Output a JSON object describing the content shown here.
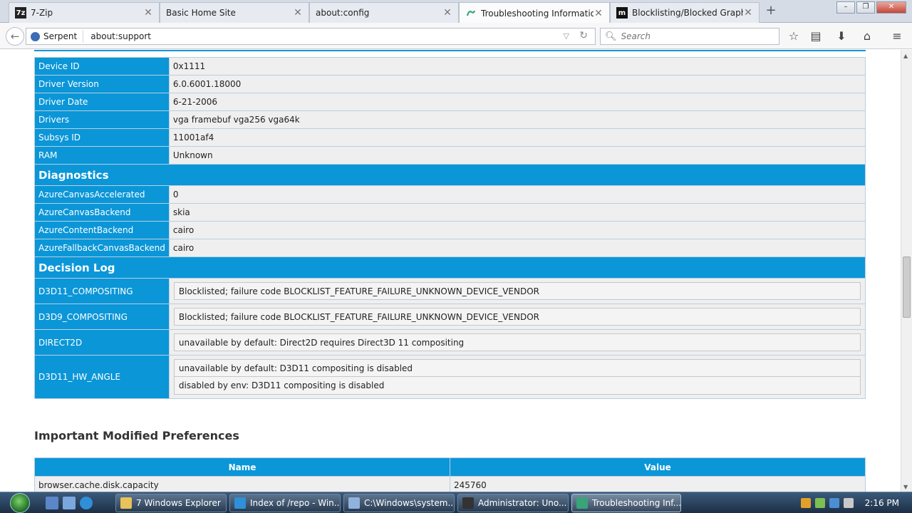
{
  "tabs": [
    {
      "title": "7-Zip",
      "favicon": "7z"
    },
    {
      "title": "Basic Home Site",
      "favicon": ""
    },
    {
      "title": "about:config",
      "favicon": ""
    },
    {
      "title": "Troubleshooting Informatio",
      "favicon": "serpent-icon"
    },
    {
      "title": "Blocklisting/Blocked Graphi",
      "favicon": "m"
    }
  ],
  "navbar": {
    "identity": "Serpent",
    "url": "about:support",
    "search_placeholder": "Search"
  },
  "graphics_rows": [
    {
      "key": "Device ID",
      "value": "0x1111"
    },
    {
      "key": "Driver Version",
      "value": "6.0.6001.18000"
    },
    {
      "key": "Driver Date",
      "value": "6-21-2006"
    },
    {
      "key": "Drivers",
      "value": "vga framebuf vga256 vga64k"
    },
    {
      "key": "Subsys ID",
      "value": "11001af4"
    },
    {
      "key": "RAM",
      "value": "Unknown"
    }
  ],
  "diagnostics": {
    "title": "Diagnostics",
    "rows": [
      {
        "key": "AzureCanvasAccelerated",
        "value": "0"
      },
      {
        "key": "AzureCanvasBackend",
        "value": "skia"
      },
      {
        "key": "AzureContentBackend",
        "value": "cairo"
      },
      {
        "key": "AzureFallbackCanvasBackend",
        "value": "cairo"
      }
    ]
  },
  "decision_log": {
    "title": "Decision Log",
    "rows": [
      {
        "key": "D3D11_COMPOSITING",
        "entries": [
          "Blocklisted; failure code BLOCKLIST_FEATURE_FAILURE_UNKNOWN_DEVICE_VENDOR"
        ]
      },
      {
        "key": "D3D9_COMPOSITING",
        "entries": [
          "Blocklisted; failure code BLOCKLIST_FEATURE_FAILURE_UNKNOWN_DEVICE_VENDOR"
        ]
      },
      {
        "key": "DIRECT2D",
        "entries": [
          "unavailable by default: Direct2D requires Direct3D 11 compositing"
        ]
      },
      {
        "key": "D3D11_HW_ANGLE",
        "entries": [
          "unavailable by default: D3D11 compositing is disabled",
          "disabled by env: D3D11 compositing is disabled"
        ]
      }
    ]
  },
  "prefs": {
    "title": "Important Modified Preferences",
    "columns": [
      "Name",
      "Value"
    ],
    "rows": [
      {
        "name": "browser.cache.disk.capacity",
        "value": "245760"
      }
    ]
  },
  "taskbar": {
    "buttons": [
      {
        "label": "7 Windows Explorer",
        "icon": "folder-icon"
      },
      {
        "label": "Index of /repo - Win...",
        "icon": "ie-icon"
      },
      {
        "label": "C:\\Windows\\system...",
        "icon": "window-icon"
      },
      {
        "label": "Administrator: Uno...",
        "icon": "cmd-icon"
      },
      {
        "label": "Troubleshooting Inf...",
        "icon": "serpent-icon"
      }
    ],
    "clock": "2:16 PM"
  },
  "colors": {
    "accent": "#0b96d8",
    "cell_bg": "#efefef"
  }
}
